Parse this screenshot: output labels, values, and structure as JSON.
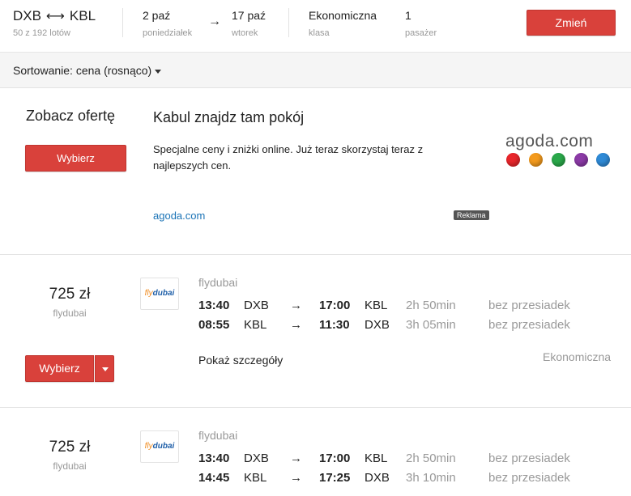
{
  "header": {
    "origin": "DXB",
    "route_arrow": "⟷",
    "destination": "KBL",
    "results_count": "50 z 192 lotów",
    "depart_date": "2 paź",
    "depart_day": "poniedziałek",
    "date_arrow": "→",
    "return_date": "17 paź",
    "return_day": "wtorek",
    "cabin": "Ekonomiczna",
    "cabin_label": "klasa",
    "passengers": "1",
    "passengers_label": "pasażer",
    "change_button": "Zmień"
  },
  "sort": {
    "label": "Sortowanie: cena (rosnąco)"
  },
  "ad": {
    "cta": "Zobacz ofertę",
    "button": "Wybierz",
    "title": "Kabul znajdz tam pokój",
    "text": "Specjalne ceny i zniżki online. Już teraz skorzystaj teraz z najlepszych cen.",
    "link": "agoda.com",
    "badge": "Reklama",
    "brand": "agoda.com",
    "brand_dots": [
      "#e8262b",
      "#f39a1d",
      "#2aa84a",
      "#8b3aa6",
      "#2f8ad6"
    ]
  },
  "flights": [
    {
      "price": "725 zł",
      "airline_under_price": "flydubai",
      "logo_fly": "fly",
      "logo_dubai": "dubai",
      "airline": "flydubai",
      "legs": [
        {
          "dep_time": "13:40",
          "dep_ap": "DXB",
          "arrow": "→",
          "arr_time": "17:00",
          "arr_ap": "KBL",
          "duration": "2h 50min",
          "stops": "bez przesiadek"
        },
        {
          "dep_time": "08:55",
          "dep_ap": "KBL",
          "arrow": "→",
          "arr_time": "11:30",
          "arr_ap": "DXB",
          "duration": "3h 05min",
          "stops": "bez przesiadek"
        }
      ],
      "details": "Pokaż szczegóły",
      "cabin": "Ekonomiczna",
      "select_button": "Wybierz"
    },
    {
      "price": "725 zł",
      "airline_under_price": "flydubai",
      "logo_fly": "fly",
      "logo_dubai": "dubai",
      "airline": "flydubai",
      "legs": [
        {
          "dep_time": "13:40",
          "dep_ap": "DXB",
          "arrow": "→",
          "arr_time": "17:00",
          "arr_ap": "KBL",
          "duration": "2h 50min",
          "stops": "bez przesiadek"
        },
        {
          "dep_time": "14:45",
          "dep_ap": "KBL",
          "arrow": "→",
          "arr_time": "17:25",
          "arr_ap": "DXB",
          "duration": "3h 10min",
          "stops": "bez przesiadek"
        }
      ]
    }
  ]
}
